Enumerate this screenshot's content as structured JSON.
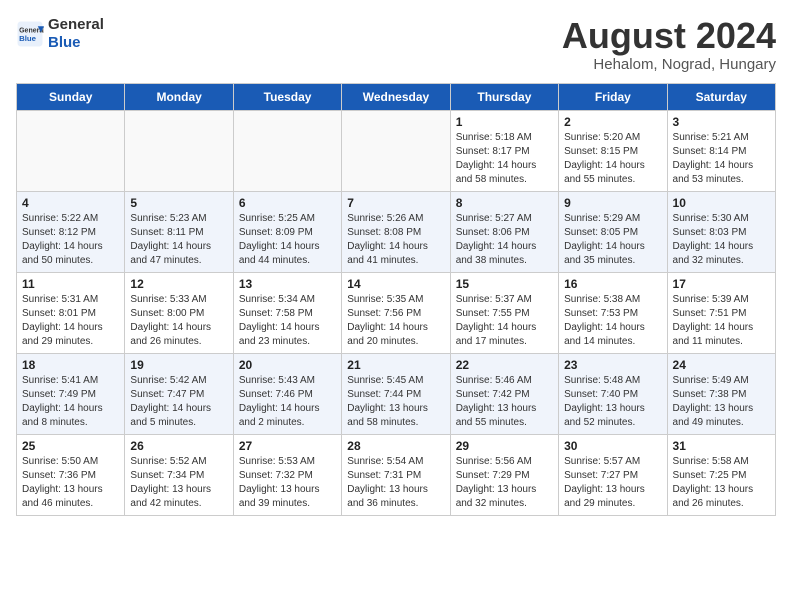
{
  "header": {
    "logo_line1": "General",
    "logo_line2": "Blue",
    "month_year": "August 2024",
    "location": "Hehalom, Nograd, Hungary"
  },
  "days_of_week": [
    "Sunday",
    "Monday",
    "Tuesday",
    "Wednesday",
    "Thursday",
    "Friday",
    "Saturday"
  ],
  "weeks": [
    [
      {
        "day": "",
        "info": ""
      },
      {
        "day": "",
        "info": ""
      },
      {
        "day": "",
        "info": ""
      },
      {
        "day": "",
        "info": ""
      },
      {
        "day": "1",
        "info": "Sunrise: 5:18 AM\nSunset: 8:17 PM\nDaylight: 14 hours\nand 58 minutes."
      },
      {
        "day": "2",
        "info": "Sunrise: 5:20 AM\nSunset: 8:15 PM\nDaylight: 14 hours\nand 55 minutes."
      },
      {
        "day": "3",
        "info": "Sunrise: 5:21 AM\nSunset: 8:14 PM\nDaylight: 14 hours\nand 53 minutes."
      }
    ],
    [
      {
        "day": "4",
        "info": "Sunrise: 5:22 AM\nSunset: 8:12 PM\nDaylight: 14 hours\nand 50 minutes."
      },
      {
        "day": "5",
        "info": "Sunrise: 5:23 AM\nSunset: 8:11 PM\nDaylight: 14 hours\nand 47 minutes."
      },
      {
        "day": "6",
        "info": "Sunrise: 5:25 AM\nSunset: 8:09 PM\nDaylight: 14 hours\nand 44 minutes."
      },
      {
        "day": "7",
        "info": "Sunrise: 5:26 AM\nSunset: 8:08 PM\nDaylight: 14 hours\nand 41 minutes."
      },
      {
        "day": "8",
        "info": "Sunrise: 5:27 AM\nSunset: 8:06 PM\nDaylight: 14 hours\nand 38 minutes."
      },
      {
        "day": "9",
        "info": "Sunrise: 5:29 AM\nSunset: 8:05 PM\nDaylight: 14 hours\nand 35 minutes."
      },
      {
        "day": "10",
        "info": "Sunrise: 5:30 AM\nSunset: 8:03 PM\nDaylight: 14 hours\nand 32 minutes."
      }
    ],
    [
      {
        "day": "11",
        "info": "Sunrise: 5:31 AM\nSunset: 8:01 PM\nDaylight: 14 hours\nand 29 minutes."
      },
      {
        "day": "12",
        "info": "Sunrise: 5:33 AM\nSunset: 8:00 PM\nDaylight: 14 hours\nand 26 minutes."
      },
      {
        "day": "13",
        "info": "Sunrise: 5:34 AM\nSunset: 7:58 PM\nDaylight: 14 hours\nand 23 minutes."
      },
      {
        "day": "14",
        "info": "Sunrise: 5:35 AM\nSunset: 7:56 PM\nDaylight: 14 hours\nand 20 minutes."
      },
      {
        "day": "15",
        "info": "Sunrise: 5:37 AM\nSunset: 7:55 PM\nDaylight: 14 hours\nand 17 minutes."
      },
      {
        "day": "16",
        "info": "Sunrise: 5:38 AM\nSunset: 7:53 PM\nDaylight: 14 hours\nand 14 minutes."
      },
      {
        "day": "17",
        "info": "Sunrise: 5:39 AM\nSunset: 7:51 PM\nDaylight: 14 hours\nand 11 minutes."
      }
    ],
    [
      {
        "day": "18",
        "info": "Sunrise: 5:41 AM\nSunset: 7:49 PM\nDaylight: 14 hours\nand 8 minutes."
      },
      {
        "day": "19",
        "info": "Sunrise: 5:42 AM\nSunset: 7:47 PM\nDaylight: 14 hours\nand 5 minutes."
      },
      {
        "day": "20",
        "info": "Sunrise: 5:43 AM\nSunset: 7:46 PM\nDaylight: 14 hours\nand 2 minutes."
      },
      {
        "day": "21",
        "info": "Sunrise: 5:45 AM\nSunset: 7:44 PM\nDaylight: 13 hours\nand 58 minutes."
      },
      {
        "day": "22",
        "info": "Sunrise: 5:46 AM\nSunset: 7:42 PM\nDaylight: 13 hours\nand 55 minutes."
      },
      {
        "day": "23",
        "info": "Sunrise: 5:48 AM\nSunset: 7:40 PM\nDaylight: 13 hours\nand 52 minutes."
      },
      {
        "day": "24",
        "info": "Sunrise: 5:49 AM\nSunset: 7:38 PM\nDaylight: 13 hours\nand 49 minutes."
      }
    ],
    [
      {
        "day": "25",
        "info": "Sunrise: 5:50 AM\nSunset: 7:36 PM\nDaylight: 13 hours\nand 46 minutes."
      },
      {
        "day": "26",
        "info": "Sunrise: 5:52 AM\nSunset: 7:34 PM\nDaylight: 13 hours\nand 42 minutes."
      },
      {
        "day": "27",
        "info": "Sunrise: 5:53 AM\nSunset: 7:32 PM\nDaylight: 13 hours\nand 39 minutes."
      },
      {
        "day": "28",
        "info": "Sunrise: 5:54 AM\nSunset: 7:31 PM\nDaylight: 13 hours\nand 36 minutes."
      },
      {
        "day": "29",
        "info": "Sunrise: 5:56 AM\nSunset: 7:29 PM\nDaylight: 13 hours\nand 32 minutes."
      },
      {
        "day": "30",
        "info": "Sunrise: 5:57 AM\nSunset: 7:27 PM\nDaylight: 13 hours\nand 29 minutes."
      },
      {
        "day": "31",
        "info": "Sunrise: 5:58 AM\nSunset: 7:25 PM\nDaylight: 13 hours\nand 26 minutes."
      }
    ]
  ]
}
